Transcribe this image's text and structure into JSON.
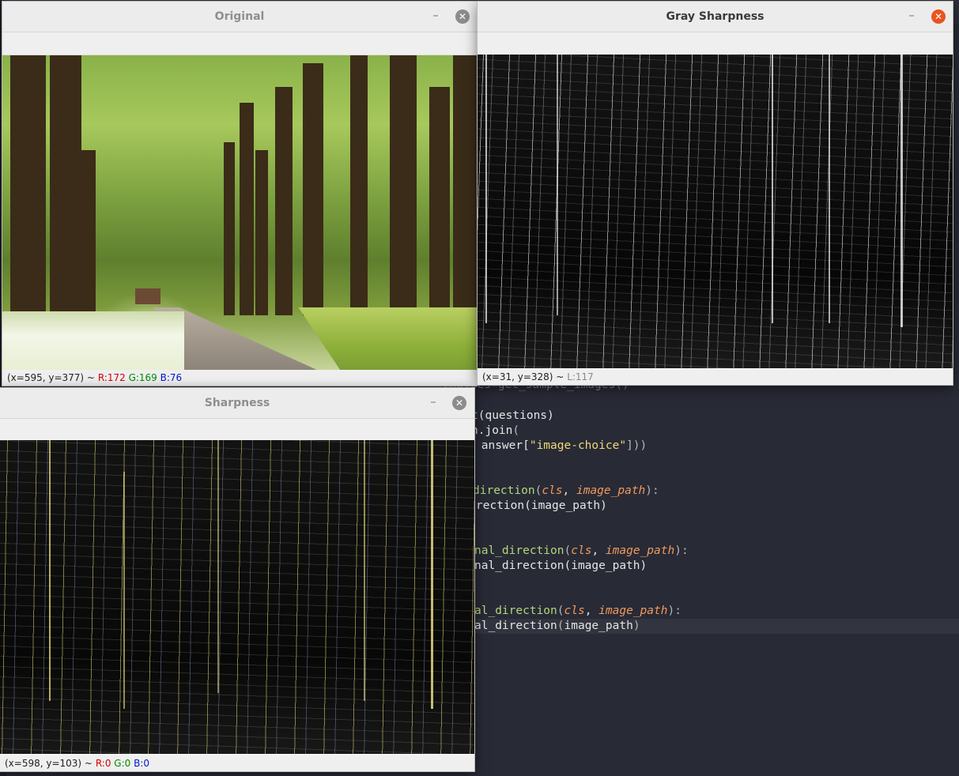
{
  "editor": {
    "lines": [
      {
        "tokens": [
          {
            "t": "choices=get_sample_images()",
            "c": "tk-faded"
          }
        ]
      },
      {
        "tokens": [
          {
            "t": "t",
            "c": "tk-fn"
          },
          {
            "t": "(questions)",
            "c": ""
          }
        ]
      },
      {
        "tokens": [
          {
            "t": "h.join",
            "c": ""
          },
          {
            "t": "(",
            "c": "tk-punc"
          }
        ]
      },
      {
        "tokens": [
          {
            "t": " answer[",
            "c": ""
          },
          {
            "t": "\"image-choice\"",
            "c": "tk-str"
          },
          {
            "t": "]))",
            "c": "tk-punc"
          }
        ]
      },
      {
        "tokens": [
          {
            "t": "direction",
            "c": "tk-fn"
          },
          {
            "t": "(",
            "c": "tk-punc"
          },
          {
            "t": "cls",
            "c": "tk-param"
          },
          {
            "t": ", ",
            "c": ""
          },
          {
            "t": "image_path",
            "c": "tk-param"
          },
          {
            "t": "):",
            "c": "tk-punc"
          }
        ]
      },
      {
        "tokens": [
          {
            "t": "rection(image_path)",
            "c": ""
          }
        ]
      },
      {
        "tokens": [
          {
            "t": "nal_direction",
            "c": "tk-fn"
          },
          {
            "t": "(",
            "c": "tk-punc"
          },
          {
            "t": "cls",
            "c": "tk-param"
          },
          {
            "t": ", ",
            "c": ""
          },
          {
            "t": "image_path",
            "c": "tk-param"
          },
          {
            "t": "):",
            "c": "tk-punc"
          }
        ]
      },
      {
        "tokens": [
          {
            "t": "nal_direction(image_path)",
            "c": ""
          }
        ]
      },
      {
        "tokens": [
          {
            "t": "al_direction",
            "c": "tk-fn"
          },
          {
            "t": "(",
            "c": "tk-punc"
          },
          {
            "t": "cls",
            "c": "tk-param"
          },
          {
            "t": ", ",
            "c": ""
          },
          {
            "t": "image_path",
            "c": "tk-param"
          },
          {
            "t": "):",
            "c": "tk-punc"
          }
        ]
      },
      {
        "tokens": [
          {
            "t": "al_direction",
            "c": ""
          },
          {
            "t": "(",
            "c": "tk-punc"
          },
          {
            "t": "image_path",
            "c": ""
          },
          {
            "t": ")",
            "c": "tk-punc"
          }
        ]
      }
    ]
  },
  "windows": {
    "original": {
      "title": "Original",
      "status": {
        "coords": "(x=595, y=377) ~",
        "r": "R:172",
        "g": "G:169",
        "b": "B:76"
      }
    },
    "gray": {
      "title": "Gray Sharpness",
      "status": {
        "coords": "(x=31, y=328) ~",
        "l": "L:117"
      }
    },
    "sharp": {
      "title": "Sharpness",
      "status": {
        "coords": "(x=598, y=103) ~",
        "r": "R:0",
        "g": "G:0",
        "b": "B:0"
      }
    }
  },
  "icons": {
    "minimize": "minimize-icon",
    "close": "close-icon"
  },
  "colors": {
    "close_active": "#e95420",
    "close_inactive": "#8c8c8c",
    "editor_bg": "#282a36"
  }
}
